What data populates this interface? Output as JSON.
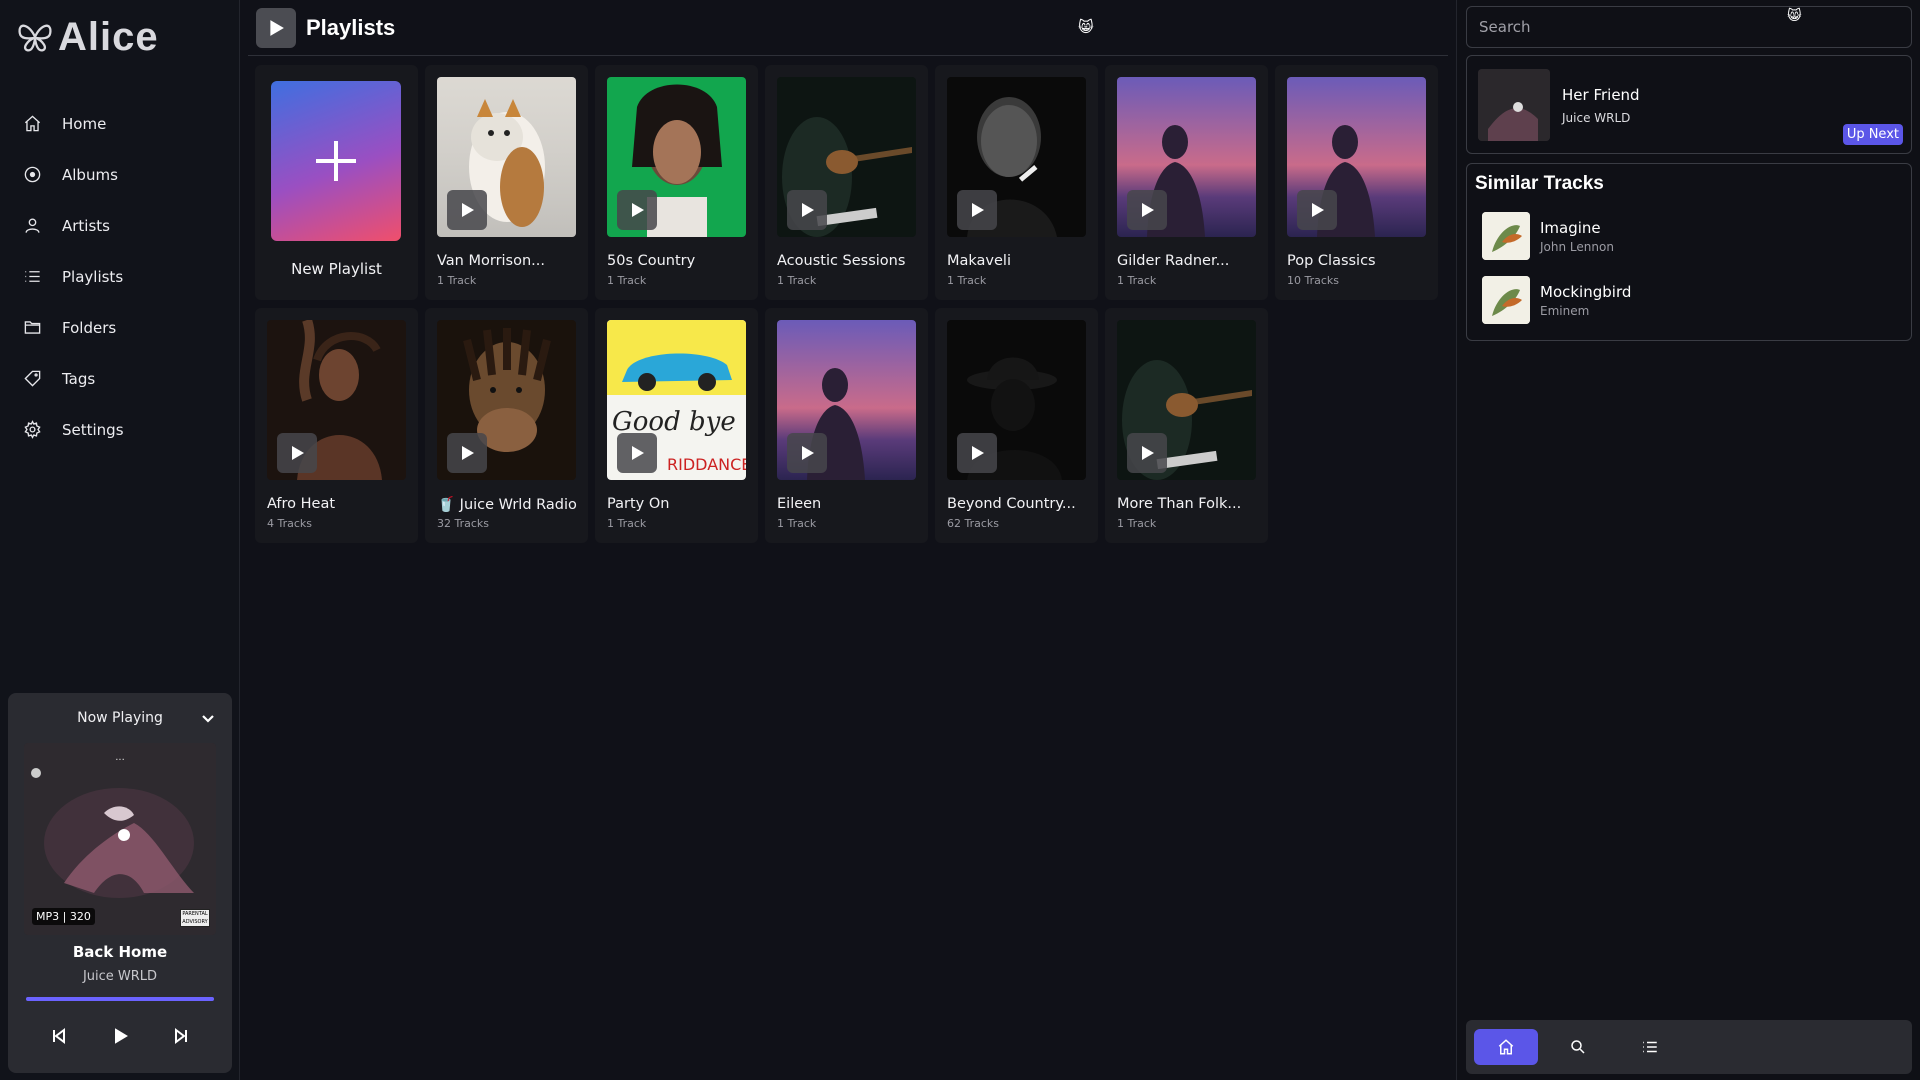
{
  "app": {
    "name": "Alice",
    "accent_color": "#5b56e8",
    "background_color": "#101118"
  },
  "sidebar": {
    "items": [
      {
        "label": "Home",
        "icon": "home-icon"
      },
      {
        "label": "Albums",
        "icon": "album-icon"
      },
      {
        "label": "Artists",
        "icon": "artist-icon"
      },
      {
        "label": "Playlists",
        "icon": "list-icon"
      },
      {
        "label": "Folders",
        "icon": "folder-icon"
      },
      {
        "label": "Tags",
        "icon": "tag-icon"
      },
      {
        "label": "Settings",
        "icon": "gear-icon"
      }
    ]
  },
  "now_playing": {
    "header": "Now Playing",
    "format": "MP3 | 320",
    "advisory": "PARENTAL ADVISORY",
    "title": "Back Home",
    "artist": "Juice WRLD",
    "progress": 1.0
  },
  "main": {
    "title": "Playlists",
    "emoji": "😸",
    "new_playlist_label": "New Playlist",
    "playlists": [
      {
        "name": "Van Morrison...",
        "count": "1 Track",
        "art": "cat"
      },
      {
        "name": "50s Country",
        "count": "1 Track",
        "art": "green-portrait"
      },
      {
        "name": "Acoustic Sessions",
        "count": "1 Track",
        "art": "guitar"
      },
      {
        "name": "Makaveli",
        "count": "1 Track",
        "art": "bw-portrait"
      },
      {
        "name": "Gilder Radner...",
        "count": "1 Track",
        "art": "sunset"
      },
      {
        "name": "Pop Classics",
        "count": "10 Tracks",
        "art": "sunset"
      },
      {
        "name": "Afro Heat",
        "count": "4 Tracks",
        "art": "warm-portrait"
      },
      {
        "name": "🥤 Juice Wrld Radio",
        "count": "32 Tracks",
        "art": "juice"
      },
      {
        "name": "Party On",
        "count": "1 Track",
        "art": "goodbye"
      },
      {
        "name": "Eileen",
        "count": "1 Track",
        "art": "sunset"
      },
      {
        "name": "Beyond Country...",
        "count": "62 Tracks",
        "art": "dark-hat"
      },
      {
        "name": "More Than Folk...",
        "count": "1 Track",
        "art": "guitar"
      }
    ]
  },
  "right": {
    "search_placeholder": "Search",
    "emoji": "😸",
    "up_next": {
      "title": "Her Friend",
      "artist": "Juice WRLD",
      "tag": "Up Next"
    },
    "similar": {
      "heading": "Similar Tracks",
      "items": [
        {
          "title": "Imagine",
          "artist": "John Lennon"
        },
        {
          "title": "Mockingbird",
          "artist": "Eminem"
        }
      ]
    },
    "bottom_nav": [
      "home-icon",
      "search-icon",
      "list-icon"
    ]
  }
}
